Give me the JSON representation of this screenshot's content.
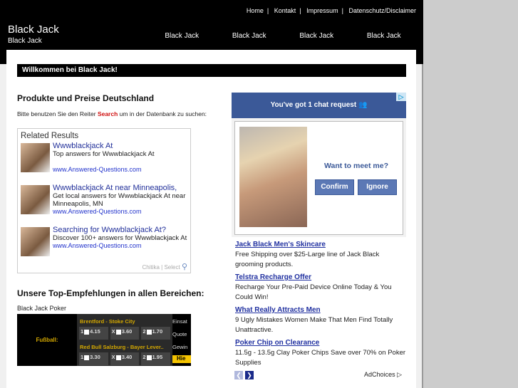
{
  "header": {
    "links": [
      "Home",
      "Kontakt",
      "Impressum",
      "Datenschutz/Disclaimer"
    ],
    "title": "Black Jack",
    "subtitle": "Black Jack",
    "nav": [
      "Black Jack",
      "Black Jack",
      "Black Jack",
      "Black Jack"
    ]
  },
  "main": {
    "welcome": "Willkommen bei Black Jack!",
    "heading": "Produkte und Preise Deutschland",
    "intro_pre": "Bitte benutzen Sie den Reiter ",
    "intro_bold": "Search",
    "intro_post": " um in der Datenbank zu suchen:",
    "related": {
      "title": "Related Results",
      "items": [
        {
          "title": "Wwwblackjack At",
          "desc": "Top answers for Wwwblackjack At",
          "url": "www.Answered-Questions.com"
        },
        {
          "title": "Wwwblackjack At near Minneapolis,",
          "desc": "Get local answers for Wwwblackjack At near Minneapolis, MN",
          "url": "www.Answered-Questions.com"
        },
        {
          "title": "Searching for Wwwblackjack At?",
          "desc": "Discover 100+ answers for Wwwblackjack At",
          "url": "www.Answered-Questions.com"
        }
      ],
      "footer": "Chitika | Select"
    },
    "top_heading": "Unsere Top-Empfehlungen in allen Bereichen:",
    "poker_label": "Black Jack Poker",
    "bet": {
      "sport": "Fußball:",
      "matches": [
        {
          "name": "Brentford - Stoke City",
          "odds": [
            [
              "1",
              "4.15"
            ],
            [
              "X",
              "3.60"
            ],
            [
              "2",
              "1.70"
            ]
          ]
        },
        {
          "name": "Red Bull Salzburg - Bayer Lever..",
          "odds": [
            [
              "1",
              "3.30"
            ],
            [
              "X",
              "3.40"
            ],
            [
              "2",
              "1.95"
            ]
          ]
        }
      ],
      "right": [
        "Einsat",
        "Quote",
        "Gewin"
      ],
      "button": "Hie"
    }
  },
  "ads": {
    "chat": "You've got 1 chat request",
    "meet": "Want to meet me?",
    "confirm": "Confirm",
    "ignore": "Ignore",
    "items": [
      {
        "title": "Jack Black Men's Skincare",
        "body": "Free Shipping over $25-Large line of Jack Black grooming products."
      },
      {
        "title": "Telstra Recharge Offer",
        "body": "Recharge Your Pre-Paid Device Online Today & You Could Win!"
      },
      {
        "title": "What Really Attracts Men",
        "body": "9 Ugly Mistakes Women Make That Men Find Totally Unattractive."
      },
      {
        "title": "Poker Chip on Clearance",
        "body": "11.5g - 13.5g Clay Poker Chips Save over 70% on Poker Supplies"
      }
    ],
    "adchoices": "AdChoices ▷"
  },
  "colors": {
    "fb": "#3b5998",
    "link": "#2030a0",
    "gold": "#d4a800"
  }
}
